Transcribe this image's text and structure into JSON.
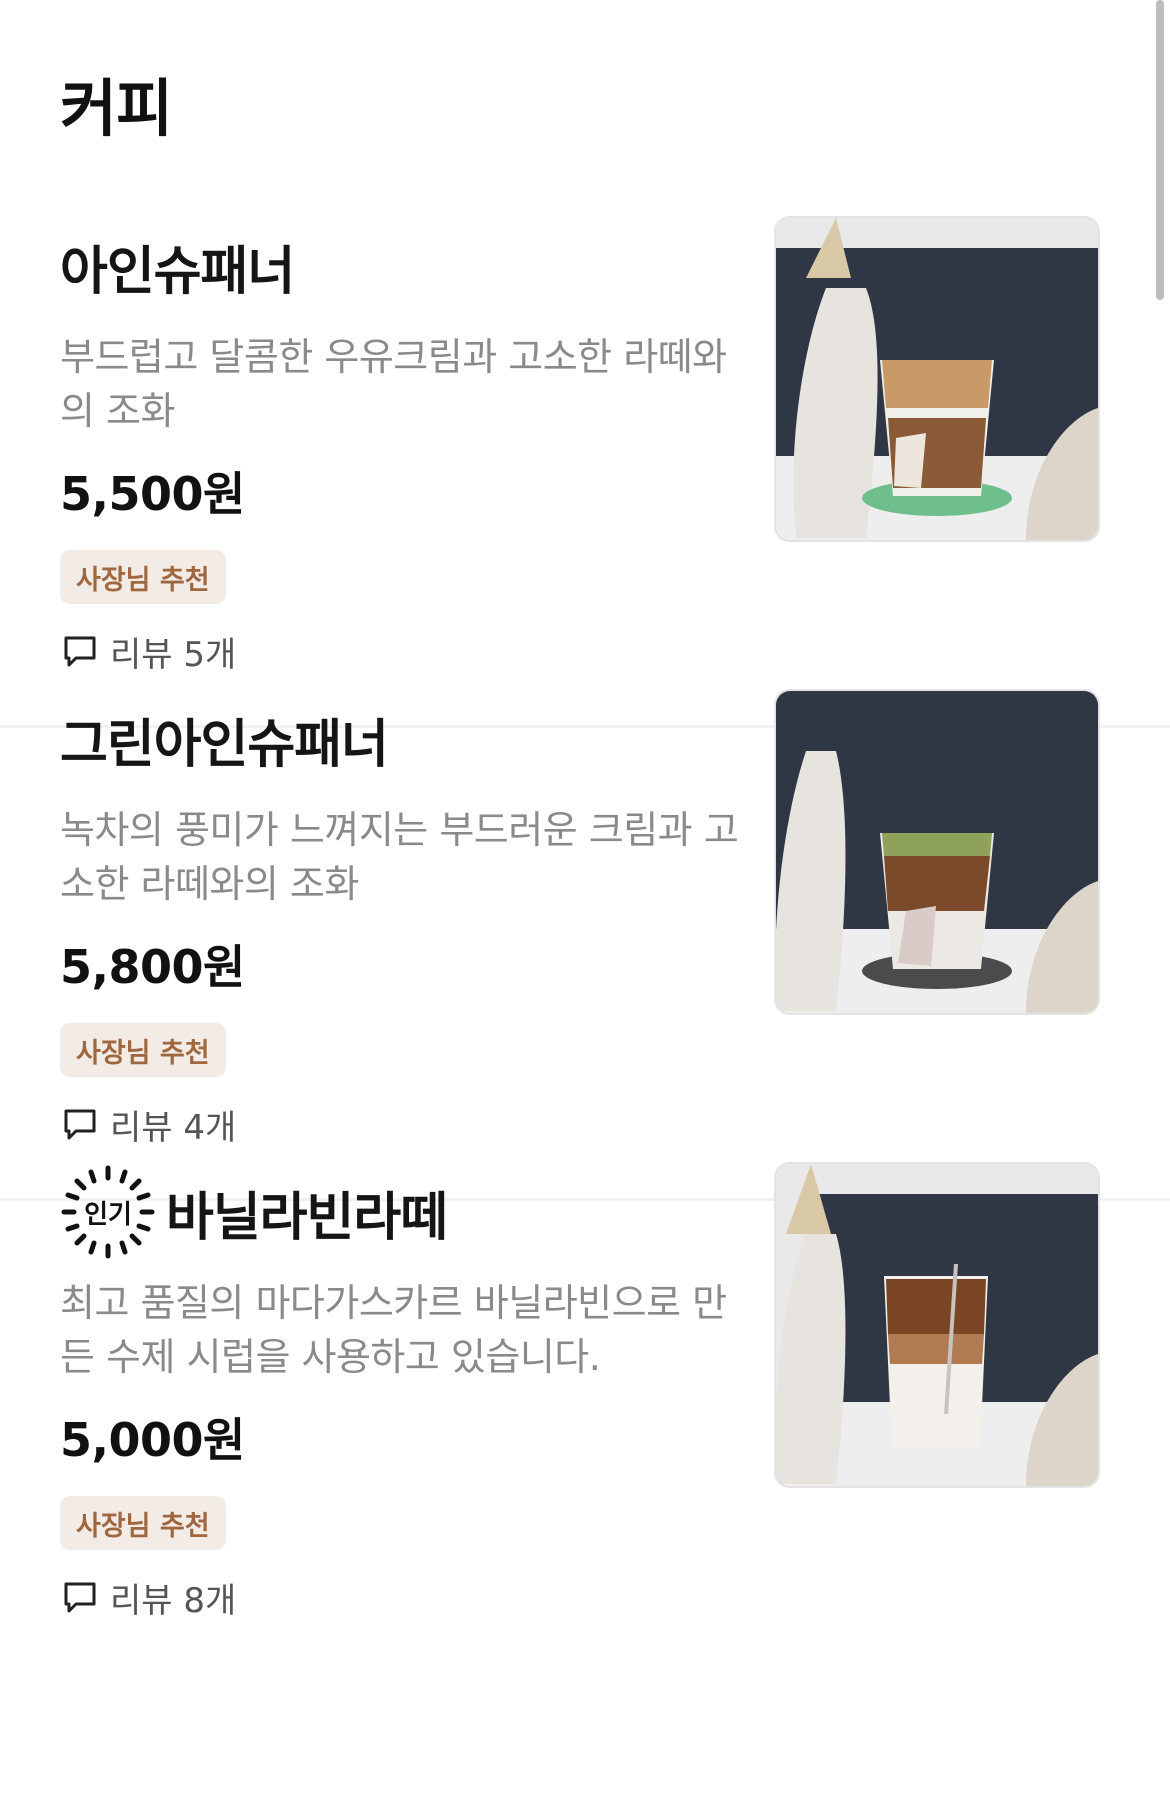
{
  "category": {
    "title": "커피"
  },
  "menu_items": [
    {
      "name": "아인슈패너",
      "description": "부드럽고 달콤한 우유크림과 고소한 라떼와의 조화",
      "price": "5,500원",
      "owner_pick_label": "사장님 추천",
      "review_text": "리뷰 5개",
      "popular_badge": null,
      "photo_subject": "einspanner-photo"
    },
    {
      "name": "그린아인슈패너",
      "description": "녹차의 풍미가 느껴지는 부드러운 크림과 고소한 라떼와의 조화",
      "price": "5,800원",
      "owner_pick_label": "사장님 추천",
      "review_text": "리뷰 4개",
      "popular_badge": null,
      "photo_subject": "green-einspanner-photo"
    },
    {
      "name": "바닐라빈라떼",
      "description": "최고 품질의 마다가스카르 바닐라빈으로 만든 수제 시럽을 사용하고 있습니다.",
      "price": "5,000원",
      "owner_pick_label": "사장님 추천",
      "review_text": "리뷰 8개",
      "popular_badge": "인기",
      "photo_subject": "vanilla-bean-latte-photo"
    }
  ],
  "colors": {
    "owner_pick_bg": "#f3ece6",
    "owner_pick_text": "#a0673f",
    "description_text": "#8a8a8a",
    "divider": "#f1f1f1"
  }
}
